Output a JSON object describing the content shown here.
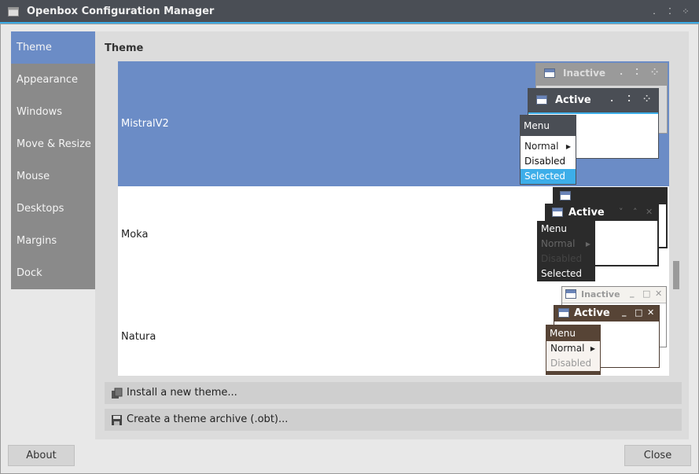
{
  "window": {
    "title": "Openbox Configuration Manager",
    "accent": "#3daee9"
  },
  "sidebar": {
    "items": [
      {
        "label": "Theme"
      },
      {
        "label": "Appearance"
      },
      {
        "label": "Windows"
      },
      {
        "label": "Move & Resize"
      },
      {
        "label": "Mouse"
      },
      {
        "label": "Desktops"
      },
      {
        "label": "Margins"
      },
      {
        "label": "Dock"
      }
    ],
    "selected": "Theme"
  },
  "main": {
    "section_title": "Theme",
    "themes": [
      {
        "name": "MistralV2",
        "selected": true,
        "preview": {
          "inactive": "Inactive",
          "active": "Active",
          "menu": "Menu",
          "normal": "Normal",
          "disabled": "Disabled",
          "selected": "Selected"
        }
      },
      {
        "name": "Moka",
        "selected": false,
        "preview": {
          "active": "Active",
          "menu": "Menu",
          "normal": "Normal",
          "disabled": "Disabled",
          "selected": "Selected"
        }
      },
      {
        "name": "Natura",
        "selected": false,
        "preview": {
          "inactive": "Inactive",
          "active": "Active",
          "menu": "Menu",
          "normal": "Normal",
          "disabled": "Disabled"
        }
      }
    ],
    "install_label": "Install a new theme...",
    "archive_label": "Create a theme archive (.obt)..."
  },
  "footer": {
    "about_label": "About",
    "close_label": "Close"
  }
}
